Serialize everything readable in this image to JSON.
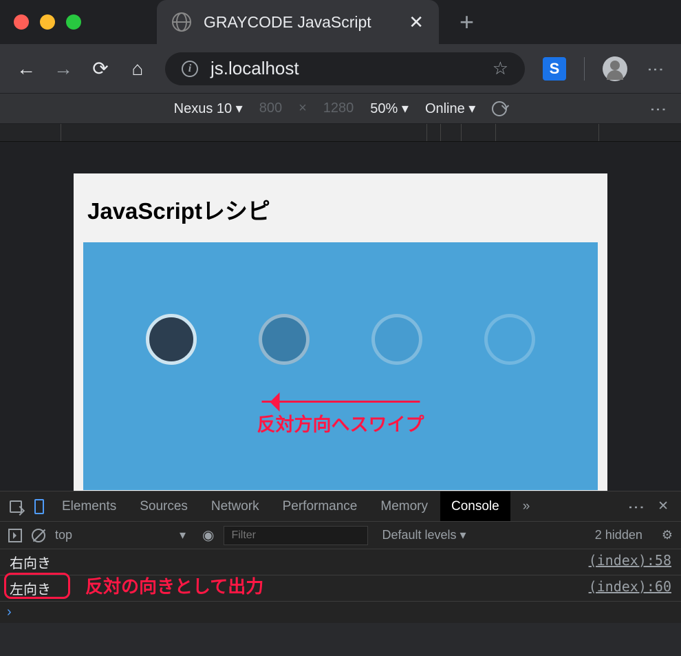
{
  "window": {
    "tab_title": "GRAYCODE JavaScript",
    "url": "js.localhost"
  },
  "device_emulation": {
    "device": "Nexus 10",
    "width": "800",
    "height": "1280",
    "separator": "×",
    "zoom": "50%",
    "network": "Online"
  },
  "page": {
    "heading": "JavaScriptレシピ"
  },
  "annotations": {
    "swipe": "反対方向へスワイプ",
    "output": "反対の向きとして出力"
  },
  "devtools": {
    "tabs": {
      "elements": "Elements",
      "sources": "Sources",
      "network": "Network",
      "performance": "Performance",
      "memory": "Memory",
      "console": "Console"
    },
    "more": "»",
    "context": "top",
    "filter_placeholder": "Filter",
    "levels": "Default levels",
    "hidden": "2 hidden"
  },
  "console_lines": [
    {
      "msg": "右向き",
      "src": "(index):58"
    },
    {
      "msg": "左向き",
      "src": "(index):60"
    }
  ]
}
